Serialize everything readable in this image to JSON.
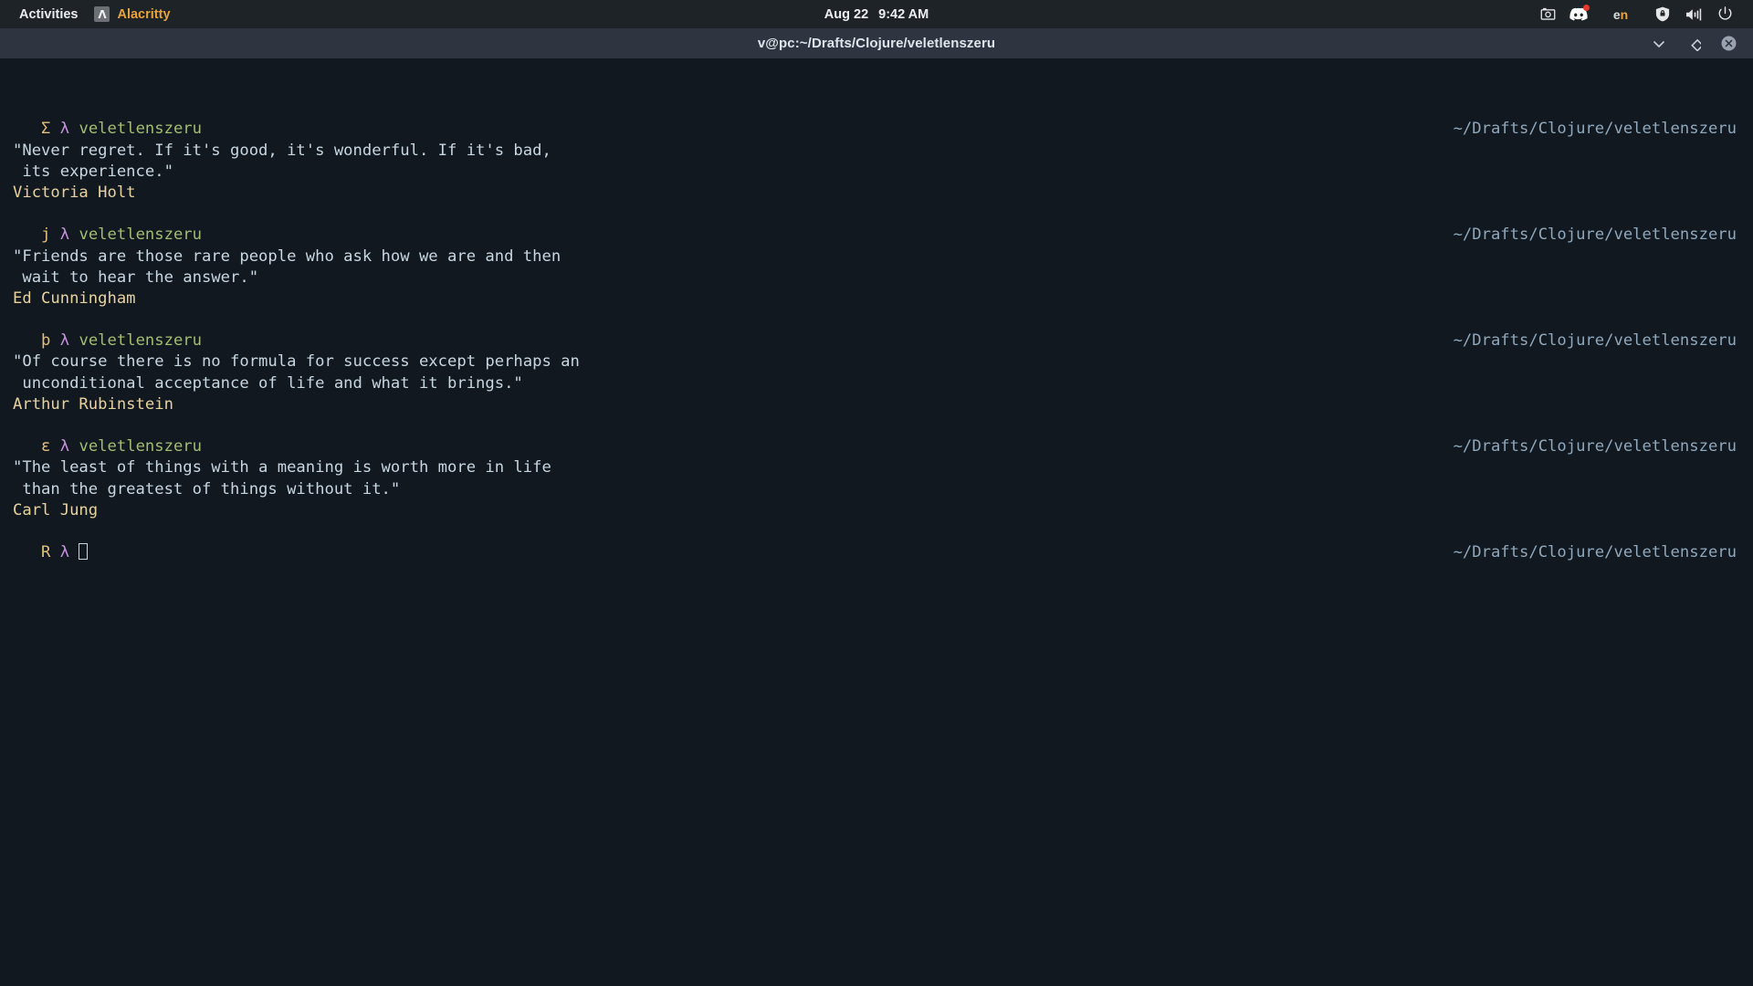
{
  "topbar": {
    "activities_label": "Activities",
    "app_name": "Alacritty",
    "app_icon_glyph": "Λ",
    "clock_date": "Aug 22",
    "clock_time": "9:42 AM",
    "language_indicator_part1": "e",
    "language_indicator_part2": "n",
    "tray": [
      {
        "name": "screenshot-icon",
        "badge": false
      },
      {
        "name": "discord-icon",
        "badge": true
      },
      {
        "name": "language-indicator",
        "badge": false
      },
      {
        "name": "shield-icon",
        "badge": false
      },
      {
        "name": "volume-icon",
        "badge": false
      },
      {
        "name": "power-icon",
        "badge": false
      }
    ]
  },
  "window": {
    "title": "v@pc:~/Drafts/Clojure/veletlenszeru",
    "controls": [
      "minimize",
      "maximize",
      "close"
    ]
  },
  "terminal": {
    "cwd_display": "~/Drafts/Clojure/veletlenszeru",
    "lambda": "λ",
    "dir_name": "veletlenszeru",
    "cursor": "",
    "blocks": [
      {
        "prompt_symbol": "Σ",
        "cwd": "~/Drafts/Clojure/veletlenszeru",
        "lines": [
          "\"Never regret. If it's good, it's wonderful. If it's bad,",
          " its experience.\""
        ],
        "author": "Victoria Holt"
      },
      {
        "prompt_symbol": "j",
        "cwd": "~/Drafts/Clojure/veletlenszeru",
        "lines": [
          "\"Friends are those rare people who ask how we are and then",
          " wait to hear the answer.\""
        ],
        "author": "Ed Cunningham"
      },
      {
        "prompt_symbol": "þ",
        "cwd": "~/Drafts/Clojure/veletlenszeru",
        "lines": [
          "\"Of course there is no formula for success except perhaps an",
          " unconditional acceptance of life and what it brings.\""
        ],
        "author": "Arthur Rubinstein"
      },
      {
        "prompt_symbol": "ε",
        "cwd": "~/Drafts/Clojure/veletlenszeru",
        "lines": [
          "\"The least of things with a meaning is worth more in life",
          " than the greatest of things without it.\""
        ],
        "author": "Carl Jung"
      }
    ],
    "active_prompt": {
      "prompt_symbol": "R",
      "cwd": "~/Drafts/Clojure/veletlenszeru",
      "input": ""
    }
  },
  "colors": {
    "topbar_bg": "#1d2326",
    "titlebar_bg": "#2e3440",
    "terminal_bg": "#111820",
    "prompt_symbol": "#e5c07b",
    "lambda": "#c792dd",
    "dirname": "#a3bd72",
    "quote_text": "#c8d6e0",
    "author_text": "#e8d3a0",
    "cwd_right": "#8fa8bc",
    "app_name": "#e8a33d",
    "badge": "#e8392f"
  }
}
